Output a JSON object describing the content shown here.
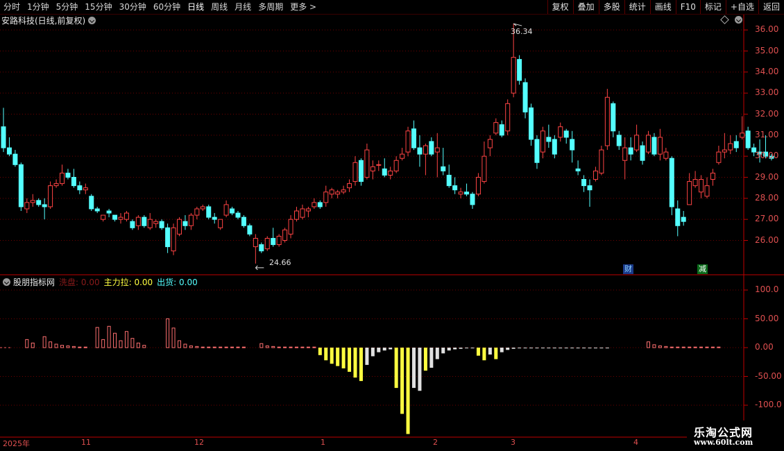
{
  "toolbar": {
    "periods": [
      "分时",
      "1分钟",
      "5分钟",
      "15分钟",
      "30分钟",
      "60分钟",
      "日线",
      "周线",
      "月线",
      "多周期",
      "更多 >"
    ],
    "active_period": "日线",
    "right_buttons": [
      "复权",
      "叠加",
      "多股",
      "统计",
      "画线",
      "F10",
      "标记",
      "+自选",
      "返回"
    ]
  },
  "stock": {
    "title": "安路科技(日线,前复权)"
  },
  "price_axis": [
    "36.00",
    "35.00",
    "34.00",
    "33.00",
    "32.00",
    "31.00",
    "30.00",
    "29.00",
    "28.00",
    "27.00",
    "26.00"
  ],
  "annotations": {
    "high": "36.34",
    "low": "24.66",
    "tag_cai": "财",
    "tag_jian": "减"
  },
  "indicator": {
    "name": "股朋指标网",
    "wash": "洗盘: 0.00",
    "main_pull": "主力拉: 0.00",
    "ship": "出货: 0.00",
    "axis": [
      "100.0",
      "50.00",
      "0.00",
      "-50.00",
      "-100.0"
    ]
  },
  "time_axis": [
    "2025年",
    "11",
    "12",
    "1",
    "2",
    "3",
    "4"
  ],
  "watermark": {
    "line1": "乐淘公式网",
    "line2": "www.60lt.com"
  },
  "colors": {
    "up": "#ff4444",
    "down": "#54ffff",
    "axis": "#c00000",
    "yellow": "#ffff40",
    "pink": "#ff7070",
    "white": "#e0e0e0"
  },
  "chart_data": {
    "type": "candlestick",
    "title": "安路科技(日线,前复权)",
    "ylim": [
      24.5,
      36.5
    ],
    "candles": [
      [
        31.4,
        32.3,
        30.2,
        30.4
      ],
      [
        30.4,
        30.9,
        30.0,
        30.1
      ],
      [
        30.1,
        30.3,
        29.5,
        29.6
      ],
      [
        29.6,
        29.7,
        27.4,
        27.6
      ],
      [
        27.5,
        28.0,
        27.3,
        27.8
      ],
      [
        27.8,
        28.2,
        27.6,
        27.9
      ],
      [
        27.9,
        28.0,
        27.6,
        27.7
      ],
      [
        27.7,
        28.0,
        27.0,
        27.6
      ],
      [
        27.6,
        28.8,
        27.5,
        28.6
      ],
      [
        28.6,
        28.9,
        28.5,
        28.7
      ],
      [
        28.7,
        29.6,
        28.6,
        29.2
      ],
      [
        29.2,
        29.4,
        28.9,
        29.0
      ],
      [
        29.0,
        29.4,
        28.5,
        28.6
      ],
      [
        28.6,
        28.8,
        28.2,
        28.4
      ],
      [
        28.4,
        28.7,
        28.2,
        28.5
      ],
      [
        28.1,
        28.2,
        27.4,
        27.5
      ],
      [
        27.5,
        27.6,
        27.3,
        27.4
      ],
      [
        27.0,
        27.2,
        26.9,
        27.2
      ],
      [
        27.4,
        27.5,
        27.1,
        27.3
      ],
      [
        27.2,
        27.2,
        26.9,
        27.0
      ],
      [
        27.0,
        27.3,
        26.8,
        27.1
      ],
      [
        27.0,
        27.4,
        26.9,
        27.3
      ],
      [
        26.9,
        27.0,
        26.5,
        26.6
      ],
      [
        26.7,
        27.2,
        26.5,
        27.1
      ],
      [
        27.1,
        27.2,
        26.6,
        26.7
      ],
      [
        26.6,
        27.3,
        26.5,
        27.0
      ],
      [
        26.8,
        27.0,
        26.6,
        26.9
      ],
      [
        26.9,
        27.0,
        26.5,
        26.6
      ],
      [
        26.6,
        26.8,
        25.4,
        25.7
      ],
      [
        25.5,
        26.8,
        25.3,
        26.6
      ],
      [
        26.3,
        27.1,
        26.2,
        27.0
      ],
      [
        26.9,
        27.2,
        26.5,
        26.7
      ],
      [
        26.7,
        27.3,
        26.5,
        27.2
      ],
      [
        27.2,
        27.6,
        27.0,
        27.5
      ],
      [
        27.5,
        27.7,
        27.4,
        27.6
      ],
      [
        27.6,
        27.7,
        27.0,
        27.1
      ],
      [
        27.1,
        27.3,
        26.8,
        27.0
      ],
      [
        26.6,
        27.0,
        26.5,
        27.0
      ],
      [
        27.2,
        27.9,
        27.1,
        27.7
      ],
      [
        27.5,
        27.6,
        27.2,
        27.3
      ],
      [
        27.3,
        27.4,
        27.0,
        27.1
      ],
      [
        27.1,
        27.2,
        26.6,
        26.7
      ],
      [
        26.7,
        26.8,
        26.2,
        26.3
      ],
      [
        25.7,
        26.3,
        24.9,
        26.1
      ],
      [
        25.8,
        25.9,
        25.4,
        25.5
      ],
      [
        25.6,
        26.2,
        25.5,
        26.1
      ],
      [
        26.1,
        26.6,
        25.7,
        25.8
      ],
      [
        25.8,
        26.3,
        25.7,
        26.2
      ],
      [
        26.0,
        26.6,
        25.9,
        26.5
      ],
      [
        26.3,
        27.2,
        26.1,
        27.0
      ],
      [
        27.0,
        27.6,
        26.9,
        27.4
      ],
      [
        27.1,
        27.7,
        27.0,
        27.5
      ],
      [
        27.4,
        27.6,
        27.1,
        27.5
      ],
      [
        27.6,
        28.0,
        27.5,
        27.8
      ],
      [
        27.8,
        27.9,
        27.5,
        27.6
      ],
      [
        27.8,
        28.6,
        27.6,
        28.3
      ],
      [
        28.2,
        28.5,
        28.0,
        28.4
      ],
      [
        28.2,
        28.4,
        28.0,
        28.3
      ],
      [
        28.3,
        28.6,
        28.2,
        28.4
      ],
      [
        28.5,
        28.9,
        28.3,
        28.7
      ],
      [
        28.8,
        30.0,
        28.6,
        29.7
      ],
      [
        29.8,
        29.9,
        28.6,
        28.8
      ],
      [
        29.0,
        30.6,
        28.9,
        30.3
      ],
      [
        29.3,
        29.8,
        28.9,
        29.5
      ],
      [
        29.6,
        29.8,
        29.3,
        29.6
      ],
      [
        29.4,
        29.9,
        29.0,
        29.1
      ],
      [
        29.1,
        29.5,
        28.9,
        29.3
      ],
      [
        29.3,
        30.0,
        29.2,
        29.8
      ],
      [
        29.9,
        30.4,
        29.8,
        30.1
      ],
      [
        30.2,
        31.4,
        30.0,
        31.2
      ],
      [
        31.3,
        31.7,
        30.3,
        30.4
      ],
      [
        30.4,
        31.0,
        29.5,
        30.1
      ],
      [
        30.1,
        30.6,
        29.1,
        30.5
      ],
      [
        30.7,
        30.9,
        30.0,
        30.1
      ],
      [
        30.2,
        31.1,
        29.0,
        30.4
      ],
      [
        29.5,
        30.4,
        29.1,
        29.3
      ],
      [
        29.1,
        29.6,
        28.5,
        28.6
      ],
      [
        28.6,
        29.0,
        28.2,
        28.4
      ],
      [
        28.2,
        28.5,
        28.0,
        28.3
      ],
      [
        28.3,
        28.7,
        28.1,
        28.2
      ],
      [
        28.2,
        28.3,
        27.5,
        27.7
      ],
      [
        28.2,
        29.2,
        28.1,
        29.0
      ],
      [
        28.8,
        30.7,
        28.7,
        30.0
      ],
      [
        30.4,
        31.0,
        30.0,
        30.8
      ],
      [
        31.1,
        31.8,
        31.0,
        31.6
      ],
      [
        31.5,
        31.7,
        30.9,
        31.0
      ],
      [
        31.2,
        32.7,
        31.0,
        32.5
      ],
      [
        33.0,
        36.3,
        32.8,
        34.7
      ],
      [
        34.6,
        34.8,
        33.4,
        33.6
      ],
      [
        33.5,
        33.7,
        31.8,
        32.1
      ],
      [
        32.3,
        32.5,
        30.5,
        30.8
      ],
      [
        30.8,
        31.0,
        29.4,
        29.7
      ],
      [
        30.2,
        31.4,
        29.9,
        31.2
      ],
      [
        30.9,
        31.5,
        30.4,
        30.7
      ],
      [
        30.8,
        31.0,
        29.9,
        30.1
      ],
      [
        30.9,
        31.6,
        30.7,
        31.4
      ],
      [
        31.2,
        31.3,
        30.6,
        30.9
      ],
      [
        30.8,
        31.2,
        29.7,
        30.3
      ],
      [
        29.4,
        29.8,
        29.1,
        29.3
      ],
      [
        28.9,
        29.1,
        28.3,
        28.6
      ],
      [
        28.6,
        28.9,
        27.6,
        28.4
      ],
      [
        28.9,
        29.5,
        28.8,
        29.3
      ],
      [
        29.2,
        30.5,
        29.1,
        30.3
      ],
      [
        30.5,
        33.2,
        30.3,
        32.8
      ],
      [
        32.5,
        32.6,
        30.9,
        31.2
      ],
      [
        31.0,
        31.2,
        30.3,
        30.5
      ],
      [
        29.8,
        30.9,
        28.9,
        30.4
      ],
      [
        30.4,
        30.9,
        29.8,
        30.1
      ],
      [
        30.3,
        31.5,
        30.2,
        31.0
      ],
      [
        30.5,
        30.7,
        29.6,
        29.8
      ],
      [
        30.2,
        31.2,
        30.1,
        31.0
      ],
      [
        30.9,
        31.1,
        30.0,
        30.1
      ],
      [
        30.1,
        31.3,
        29.8,
        30.9
      ],
      [
        29.9,
        30.4,
        29.8,
        30.2
      ],
      [
        29.9,
        30.0,
        27.2,
        27.6
      ],
      [
        27.5,
        27.9,
        26.2,
        26.7
      ],
      [
        27.1,
        27.4,
        26.7,
        26.9
      ],
      [
        27.7,
        29.2,
        27.7,
        28.8
      ],
      [
        28.6,
        29.3,
        28.5,
        28.9
      ],
      [
        28.3,
        29.1,
        28.0,
        28.9
      ],
      [
        28.1,
        29.0,
        28.0,
        28.6
      ],
      [
        28.9,
        29.4,
        28.6,
        29.2
      ],
      [
        29.7,
        30.5,
        29.6,
        30.2
      ],
      [
        30.2,
        31.1,
        29.9,
        30.3
      ],
      [
        30.3,
        31.0,
        30.1,
        30.6
      ],
      [
        30.7,
        31.0,
        30.2,
        30.4
      ],
      [
        30.9,
        31.9,
        30.8,
        31.1
      ],
      [
        31.2,
        31.4,
        30.3,
        30.4
      ],
      [
        30.4,
        30.6,
        30.0,
        30.2
      ],
      [
        30.2,
        30.8,
        29.7,
        30.1
      ],
      [
        30.2,
        31.0,
        29.9,
        30.0
      ],
      [
        30.0,
        30.1,
        29.8,
        29.9
      ]
    ],
    "indicator_bars": [
      {
        "i": 4,
        "v": 14,
        "c": "pink"
      },
      {
        "i": 5,
        "v": 8,
        "c": "pink"
      },
      {
        "i": 7,
        "v": 19,
        "c": "pink"
      },
      {
        "i": 8,
        "v": 10,
        "c": "pink"
      },
      {
        "i": 9,
        "v": 6,
        "c": "pink"
      },
      {
        "i": 10,
        "v": 4,
        "c": "pink"
      },
      {
        "i": 11,
        "v": 3,
        "c": "pink"
      },
      {
        "i": 12,
        "v": 2,
        "c": "pink"
      },
      {
        "i": 13,
        "v": 1,
        "c": "pink"
      },
      {
        "i": 14,
        "v": 1,
        "c": "pink"
      },
      {
        "i": 16,
        "v": 35,
        "c": "pink"
      },
      {
        "i": 17,
        "v": 14,
        "c": "pink"
      },
      {
        "i": 18,
        "v": 37,
        "c": "pink"
      },
      {
        "i": 19,
        "v": 25,
        "c": "pink"
      },
      {
        "i": 20,
        "v": 12,
        "c": "pink"
      },
      {
        "i": 21,
        "v": 28,
        "c": "pink"
      },
      {
        "i": 22,
        "v": 16,
        "c": "pink"
      },
      {
        "i": 23,
        "v": 8,
        "c": "pink"
      },
      {
        "i": 24,
        "v": 4,
        "c": "pink"
      },
      {
        "i": 28,
        "v": 50,
        "c": "pink"
      },
      {
        "i": 29,
        "v": 34,
        "c": "pink"
      },
      {
        "i": 30,
        "v": 12,
        "c": "pink"
      },
      {
        "i": 31,
        "v": 6,
        "c": "pink"
      },
      {
        "i": 32,
        "v": 3,
        "c": "pink"
      },
      {
        "i": 33,
        "v": 2,
        "c": "pink"
      },
      {
        "i": 34,
        "v": 1,
        "c": "pink"
      },
      {
        "i": 35,
        "v": 1,
        "c": "pink"
      },
      {
        "i": 36,
        "v": 1,
        "c": "pink"
      },
      {
        "i": 37,
        "v": 1,
        "c": "pink"
      },
      {
        "i": 38,
        "v": 1,
        "c": "pink"
      },
      {
        "i": 39,
        "v": 1,
        "c": "pink"
      },
      {
        "i": 40,
        "v": 1,
        "c": "pink"
      },
      {
        "i": 41,
        "v": 1,
        "c": "pink"
      },
      {
        "i": 44,
        "v": 7,
        "c": "pink"
      },
      {
        "i": 45,
        "v": 3,
        "c": "pink"
      },
      {
        "i": 46,
        "v": 2,
        "c": "pink"
      },
      {
        "i": 47,
        "v": 1,
        "c": "pink"
      },
      {
        "i": 48,
        "v": 1,
        "c": "pink"
      },
      {
        "i": 49,
        "v": 1,
        "c": "pink"
      },
      {
        "i": 50,
        "v": 1,
        "c": "pink"
      },
      {
        "i": 51,
        "v": 1,
        "c": "pink"
      },
      {
        "i": 52,
        "v": 1,
        "c": "pink"
      },
      {
        "i": 53,
        "v": 1,
        "c": "pink"
      },
      {
        "i": 54,
        "v": -13,
        "c": "yellow"
      },
      {
        "i": 55,
        "v": -22,
        "c": "yellow"
      },
      {
        "i": 56,
        "v": -28,
        "c": "yellow"
      },
      {
        "i": 57,
        "v": -32,
        "c": "yellow"
      },
      {
        "i": 58,
        "v": -36,
        "c": "yellow"
      },
      {
        "i": 59,
        "v": -42,
        "c": "yellow"
      },
      {
        "i": 60,
        "v": -52,
        "c": "yellow"
      },
      {
        "i": 61,
        "v": -58,
        "c": "yellow"
      },
      {
        "i": 62,
        "v": -30,
        "c": "white"
      },
      {
        "i": 63,
        "v": -15,
        "c": "white"
      },
      {
        "i": 64,
        "v": -8,
        "c": "white"
      },
      {
        "i": 65,
        "v": -5,
        "c": "white"
      },
      {
        "i": 66,
        "v": -3,
        "c": "white"
      },
      {
        "i": 67,
        "v": -70,
        "c": "yellow"
      },
      {
        "i": 68,
        "v": -115,
        "c": "yellow"
      },
      {
        "i": 69,
        "v": -150,
        "c": "yellow"
      },
      {
        "i": 70,
        "v": -70,
        "c": "white"
      },
      {
        "i": 71,
        "v": -75,
        "c": "white"
      },
      {
        "i": 72,
        "v": -40,
        "c": "yellow"
      },
      {
        "i": 73,
        "v": -35,
        "c": "white"
      },
      {
        "i": 74,
        "v": -20,
        "c": "white"
      },
      {
        "i": 75,
        "v": -10,
        "c": "white"
      },
      {
        "i": 76,
        "v": -5,
        "c": "white"
      },
      {
        "i": 77,
        "v": -3,
        "c": "white"
      },
      {
        "i": 78,
        "v": -2,
        "c": "white"
      },
      {
        "i": 79,
        "v": -1,
        "c": "white"
      },
      {
        "i": 80,
        "v": -1,
        "c": "white"
      },
      {
        "i": 81,
        "v": -14,
        "c": "yellow"
      },
      {
        "i": 82,
        "v": -22,
        "c": "yellow"
      },
      {
        "i": 83,
        "v": -12,
        "c": "white"
      },
      {
        "i": 84,
        "v": -20,
        "c": "yellow"
      },
      {
        "i": 85,
        "v": -8,
        "c": "white"
      },
      {
        "i": 86,
        "v": -4,
        "c": "white"
      },
      {
        "i": 87,
        "v": -2,
        "c": "white"
      },
      {
        "i": 88,
        "v": -1,
        "c": "white"
      },
      {
        "i": 89,
        "v": -1,
        "c": "white"
      },
      {
        "i": 90,
        "v": -1,
        "c": "white"
      },
      {
        "i": 91,
        "v": -1,
        "c": "white"
      },
      {
        "i": 92,
        "v": -1,
        "c": "white"
      },
      {
        "i": 93,
        "v": -1,
        "c": "white"
      },
      {
        "i": 94,
        "v": -1,
        "c": "white"
      },
      {
        "i": 95,
        "v": -1,
        "c": "white"
      },
      {
        "i": 96,
        "v": -1,
        "c": "white"
      },
      {
        "i": 97,
        "v": -1,
        "c": "white"
      },
      {
        "i": 98,
        "v": -1,
        "c": "white"
      },
      {
        "i": 99,
        "v": -1,
        "c": "white"
      },
      {
        "i": 100,
        "v": -1,
        "c": "white"
      },
      {
        "i": 101,
        "v": -1,
        "c": "white"
      },
      {
        "i": 102,
        "v": -1,
        "c": "white"
      },
      {
        "i": 103,
        "v": -1,
        "c": "white"
      },
      {
        "i": 110,
        "v": 10,
        "c": "pink"
      },
      {
        "i": 111,
        "v": 5,
        "c": "pink"
      },
      {
        "i": 112,
        "v": 3,
        "c": "pink"
      },
      {
        "i": 113,
        "v": 2,
        "c": "pink"
      },
      {
        "i": 114,
        "v": 1,
        "c": "pink"
      },
      {
        "i": 115,
        "v": 1,
        "c": "pink"
      },
      {
        "i": 116,
        "v": 1,
        "c": "pink"
      },
      {
        "i": 117,
        "v": 1,
        "c": "pink"
      },
      {
        "i": 118,
        "v": 1,
        "c": "pink"
      },
      {
        "i": 119,
        "v": 1,
        "c": "pink"
      },
      {
        "i": 120,
        "v": 1,
        "c": "pink"
      },
      {
        "i": 121,
        "v": 1,
        "c": "pink"
      },
      {
        "i": 122,
        "v": 1,
        "c": "pink"
      }
    ]
  }
}
